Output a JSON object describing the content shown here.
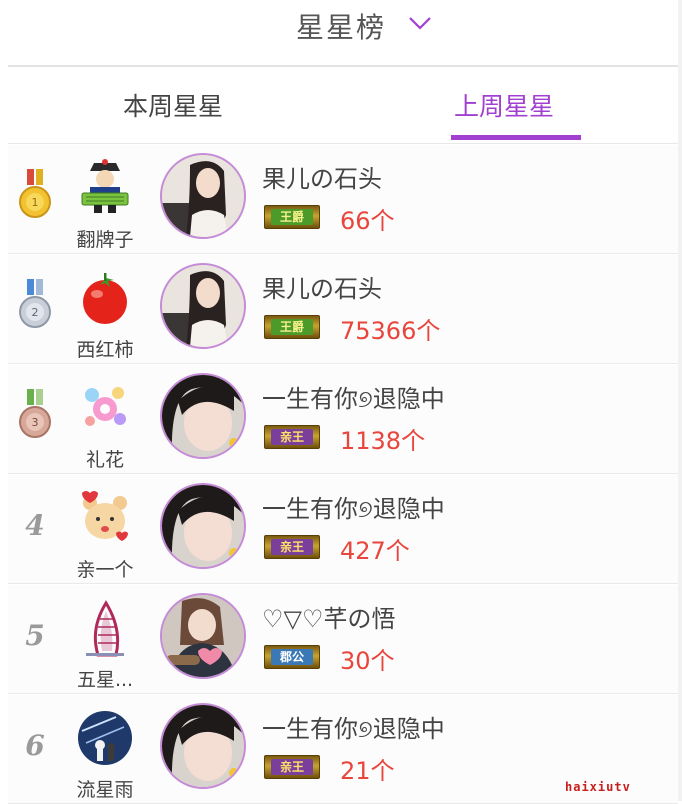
{
  "header": {
    "title": "星星榜"
  },
  "tabs": [
    {
      "label": "本周星星",
      "active": false
    },
    {
      "label": "上周星星",
      "active": true
    }
  ],
  "accent_color": "#a13fd0",
  "count_color": "#e8453c",
  "ranking": [
    {
      "rank": "1",
      "medal": "gold-medal",
      "gift_icon": "official-figure-icon",
      "gift": "翻牌子",
      "user": "果儿の石头",
      "title_badge": "王爵",
      "badge_style": "green",
      "count": "66个"
    },
    {
      "rank": "2",
      "medal": "silver-medal",
      "gift_icon": "tomato-icon",
      "gift": "西红柿",
      "user": "果儿の石头",
      "title_badge": "王爵",
      "badge_style": "green",
      "count": "75366个"
    },
    {
      "rank": "3",
      "medal": "bronze-medal",
      "gift_icon": "fireworks-icon",
      "gift": "礼花",
      "user": "一生有你୭退隐中",
      "title_badge": "亲王",
      "badge_style": "purple",
      "count": "1138个"
    },
    {
      "rank": "4",
      "medal": null,
      "gift_icon": "kiss-bear-icon",
      "gift": "亲一个",
      "user": "一生有你୭退隐中",
      "title_badge": "亲王",
      "badge_style": "purple",
      "count": "427个"
    },
    {
      "rank": "5",
      "medal": null,
      "gift_icon": "sail-hotel-icon",
      "gift": "五星...",
      "user": "♡▽♡芊の悟",
      "title_badge": "郡公",
      "badge_style": "blue",
      "count": "30个"
    },
    {
      "rank": "6",
      "medal": null,
      "gift_icon": "meteor-couple-icon",
      "gift": "流星雨",
      "user": "一生有你୭退隐中",
      "title_badge": "亲王",
      "badge_style": "purple",
      "count": "21个"
    }
  ],
  "watermark": "haixiutv"
}
